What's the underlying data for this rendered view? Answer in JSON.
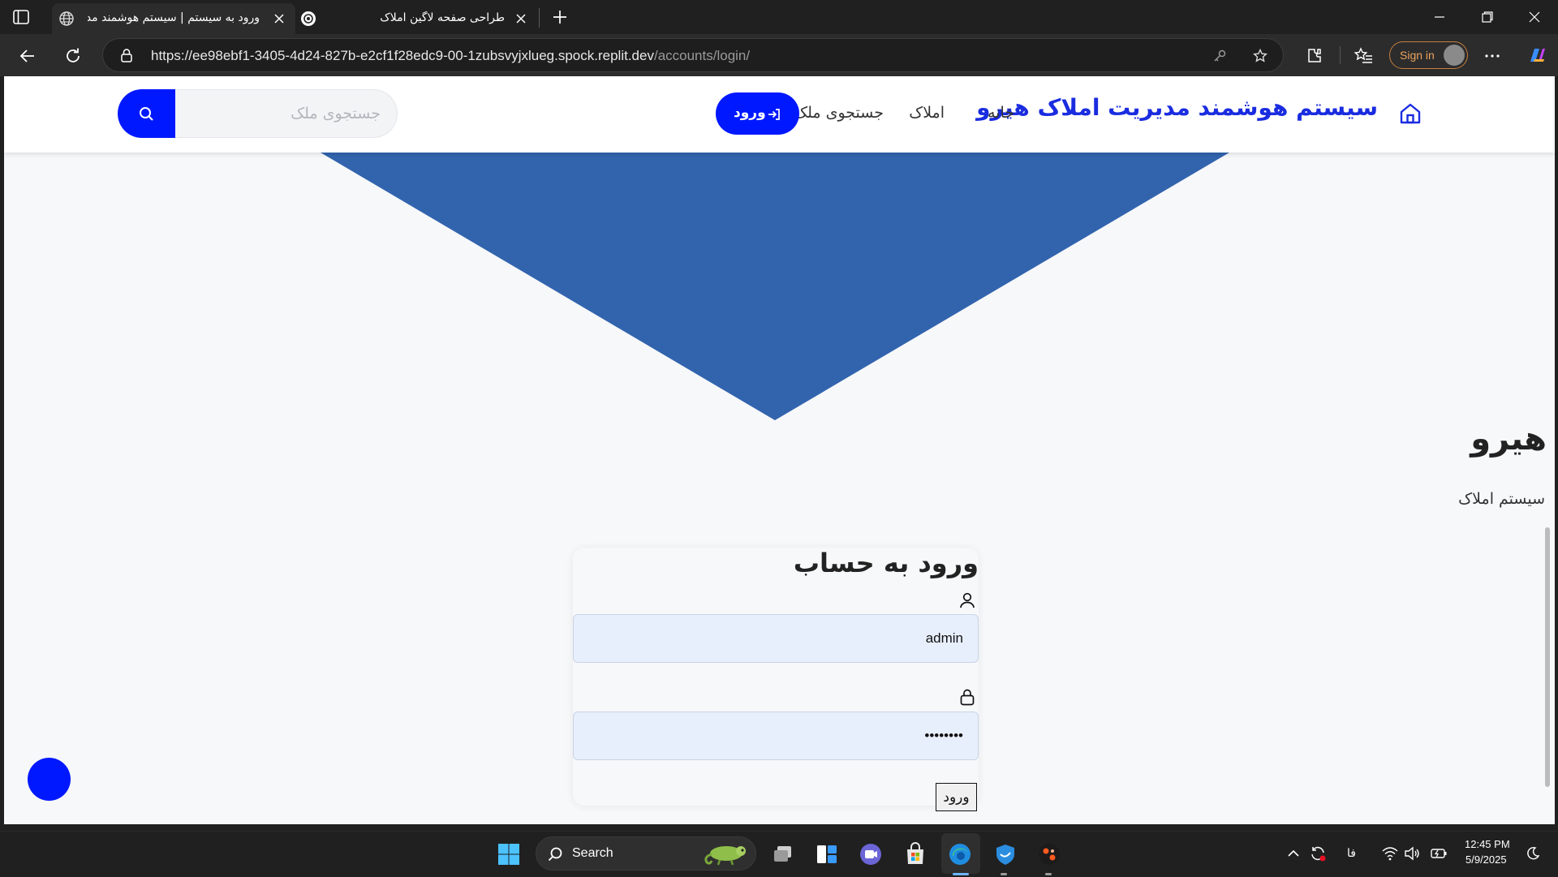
{
  "browser": {
    "tabs": [
      {
        "title": "ورود به سیستم | سیستم هوشمند مدیریت املاک هیرو",
        "favicon": "globe-icon",
        "active": true
      },
      {
        "title": "طراحی صفحه لاگین املاک",
        "favicon": "chatgpt-icon",
        "active": false
      }
    ],
    "address": {
      "host": "https://ee98ebf1-3405-4d24-827b-e2cf1f28edc9-00-1zubsvyjxlueg.spock.replit.dev",
      "path": "/accounts/login/"
    },
    "sign_in_label": "Sign in"
  },
  "site": {
    "brand": "سیستم هوشمند مدیریت املاک هیرو",
    "nav": {
      "home": "خانه",
      "properties": "املاک",
      "search": "جستجوی ملک"
    },
    "login_button": "ورود",
    "search_placeholder": "جستجوی ملک",
    "side_title": "هیرو",
    "side_subtitle": "سیستم املاک",
    "colors": {
      "primary": "#0018ff",
      "hero_triangle": "#3264ae",
      "brand_text": "#1a2ce0"
    }
  },
  "login_card": {
    "title": "ورود به حساب",
    "username_value": "admin",
    "password_value": "••••••••",
    "submit_label": "ورود"
  },
  "taskbar": {
    "search_label": "Search",
    "language": "فا",
    "time": "12:45 PM",
    "date": "5/9/2025"
  }
}
